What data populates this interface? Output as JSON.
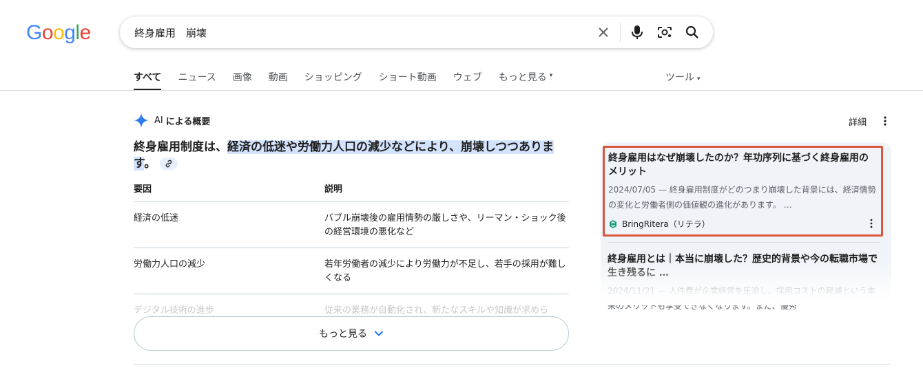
{
  "logo": {
    "letters": [
      "G",
      "o",
      "o",
      "g",
      "l",
      "e"
    ],
    "colors": [
      "#4285F4",
      "#EA4335",
      "#FBBC05",
      "#4285F4",
      "#34A853",
      "#EA4335"
    ]
  },
  "search": {
    "query": "終身雇用　崩壊"
  },
  "tabs": [
    {
      "label": "すべて",
      "active": true
    },
    {
      "label": "ニュース"
    },
    {
      "label": "画像"
    },
    {
      "label": "動画"
    },
    {
      "label": "ショッピング"
    },
    {
      "label": "ショート動画"
    },
    {
      "label": "ウェブ"
    },
    {
      "label": "もっと見る",
      "caret": "▾"
    }
  ],
  "tools": {
    "label": "ツール",
    "caret": "▾"
  },
  "ai_overview": {
    "label_prefix": "AI",
    "label": "による概要",
    "details": "詳細",
    "summary_plain": "終身雇用制度は、",
    "summary_highlight_1": "経済の低迷や労働力人口の減少などにより、崩壊しつつあり",
    "summary_highlight_2": "ます",
    "summary_end": "。",
    "table": {
      "headers": [
        "要因",
        "説明"
      ],
      "rows": [
        [
          "経済の低迷",
          "バブル崩壊後の雇用情勢の厳しさや、リーマン・ショック後の経営環境の悪化など"
        ],
        [
          "労働力人口の減少",
          "若年労働者の減少により労働力が不足し、若手の採用が難しくなる"
        ],
        [
          "デジタル技術の進歩",
          "従来の業務が自動化され、新たなスキルや知識が求めら"
        ]
      ]
    },
    "more_label": "もっと見る"
  },
  "sources": [
    {
      "title": "終身雇用はなぜ崩壊したのか？年功序列に基づく終身雇用のメリット",
      "snippet": "2024/07/05 — 終身雇用制度がどのつまり崩壊した背景には、経済情勢の変化と労働者側の価値観の進化があります。 …",
      "source": "BringRitera（リテラ）"
    },
    {
      "title": "終身雇用とは｜本当に崩壊した？歴史的背景や今の転職市場で生き残るに …",
      "snippet": "2024/11/21 — 人件費が企業経営を圧迫し、採用コストの軽減という本来のメリットも享受できなくなります。また、優秀"
    }
  ]
}
